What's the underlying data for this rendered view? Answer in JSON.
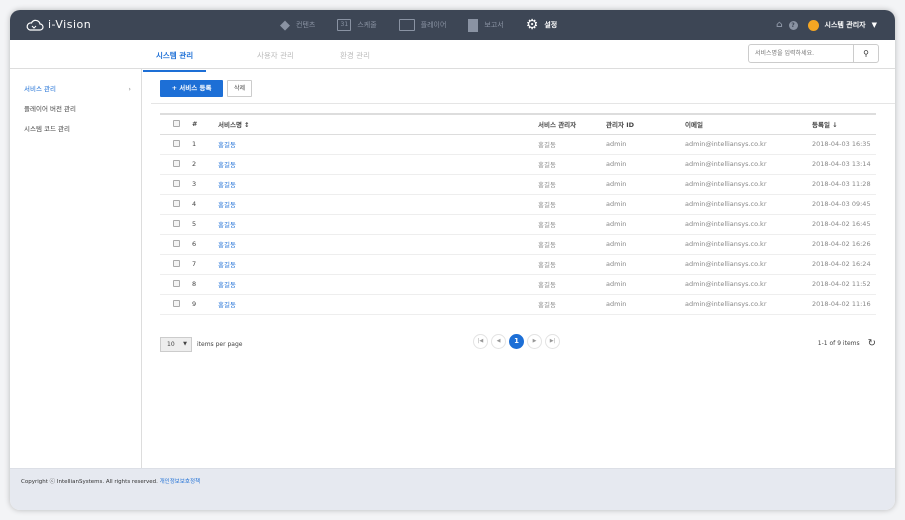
{
  "app": {
    "title": "i-Vision"
  },
  "nav": [
    {
      "label": "컨텐츠",
      "icon": "shapes-icon"
    },
    {
      "label": "스케줄",
      "icon": "calendar-icon",
      "badge": "31"
    },
    {
      "label": "플레이어",
      "icon": "monitor-icon"
    },
    {
      "label": "보고서",
      "icon": "document-icon"
    },
    {
      "label": "설정",
      "icon": "gear-icon",
      "active": true
    }
  ],
  "user": {
    "name": "시스템 관리자"
  },
  "tabs": [
    "시스템 관리",
    "사용자 관리",
    "환경 관리"
  ],
  "search": {
    "placeholder": "서비스명을 입력하세요."
  },
  "sidebar": [
    {
      "label": "서비스 관리",
      "chev": "›"
    },
    {
      "label": "플레이어 버전 관리"
    },
    {
      "label": "시스템 코드 관리"
    }
  ],
  "toolbar": {
    "add": "+ 서비스 등록",
    "delete": "삭제"
  },
  "table": {
    "headers": [
      "#",
      "서비스명 ↕",
      "서비스 관리자",
      "관리자 ID",
      "이메일",
      "등록일 ↓"
    ],
    "rows": [
      [
        "1",
        "홍길동",
        "홍길동",
        "admin",
        "admin@intelliansys.co.kr",
        "2018-04-03 16:35"
      ],
      [
        "2",
        "홍길동",
        "홍길동",
        "admin",
        "admin@intelliansys.co.kr",
        "2018-04-03 13:14"
      ],
      [
        "3",
        "홍길동",
        "홍길동",
        "admin",
        "admin@intelliansys.co.kr",
        "2018-04-03 11:28"
      ],
      [
        "4",
        "홍길동",
        "홍길동",
        "admin",
        "admin@intelliansys.co.kr",
        "2018-04-03 09:45"
      ],
      [
        "5",
        "홍길동",
        "홍길동",
        "admin",
        "admin@intelliansys.co.kr",
        "2018-04-02 16:45"
      ],
      [
        "6",
        "홍길동",
        "홍길동",
        "admin",
        "admin@intelliansys.co.kr",
        "2018-04-02 16:26"
      ],
      [
        "7",
        "홍길동",
        "홍길동",
        "admin",
        "admin@intelliansys.co.kr",
        "2018-04-02 16:24"
      ],
      [
        "8",
        "홍길동",
        "홍길동",
        "admin",
        "admin@intelliansys.co.kr",
        "2018-04-02 11:52"
      ],
      [
        "9",
        "홍길동",
        "홍길동",
        "admin",
        "admin@intelliansys.co.kr",
        "2018-04-02 11:16"
      ]
    ]
  },
  "pagination": {
    "per_page": "10",
    "per_page_label": "items per page",
    "current": "1",
    "summary": "1-1 of 9 items"
  },
  "footer": {
    "copyright": "Copyright ⓒ IntellianSystems. All rights reserved.",
    "privacy": "개인정보보호정책"
  }
}
